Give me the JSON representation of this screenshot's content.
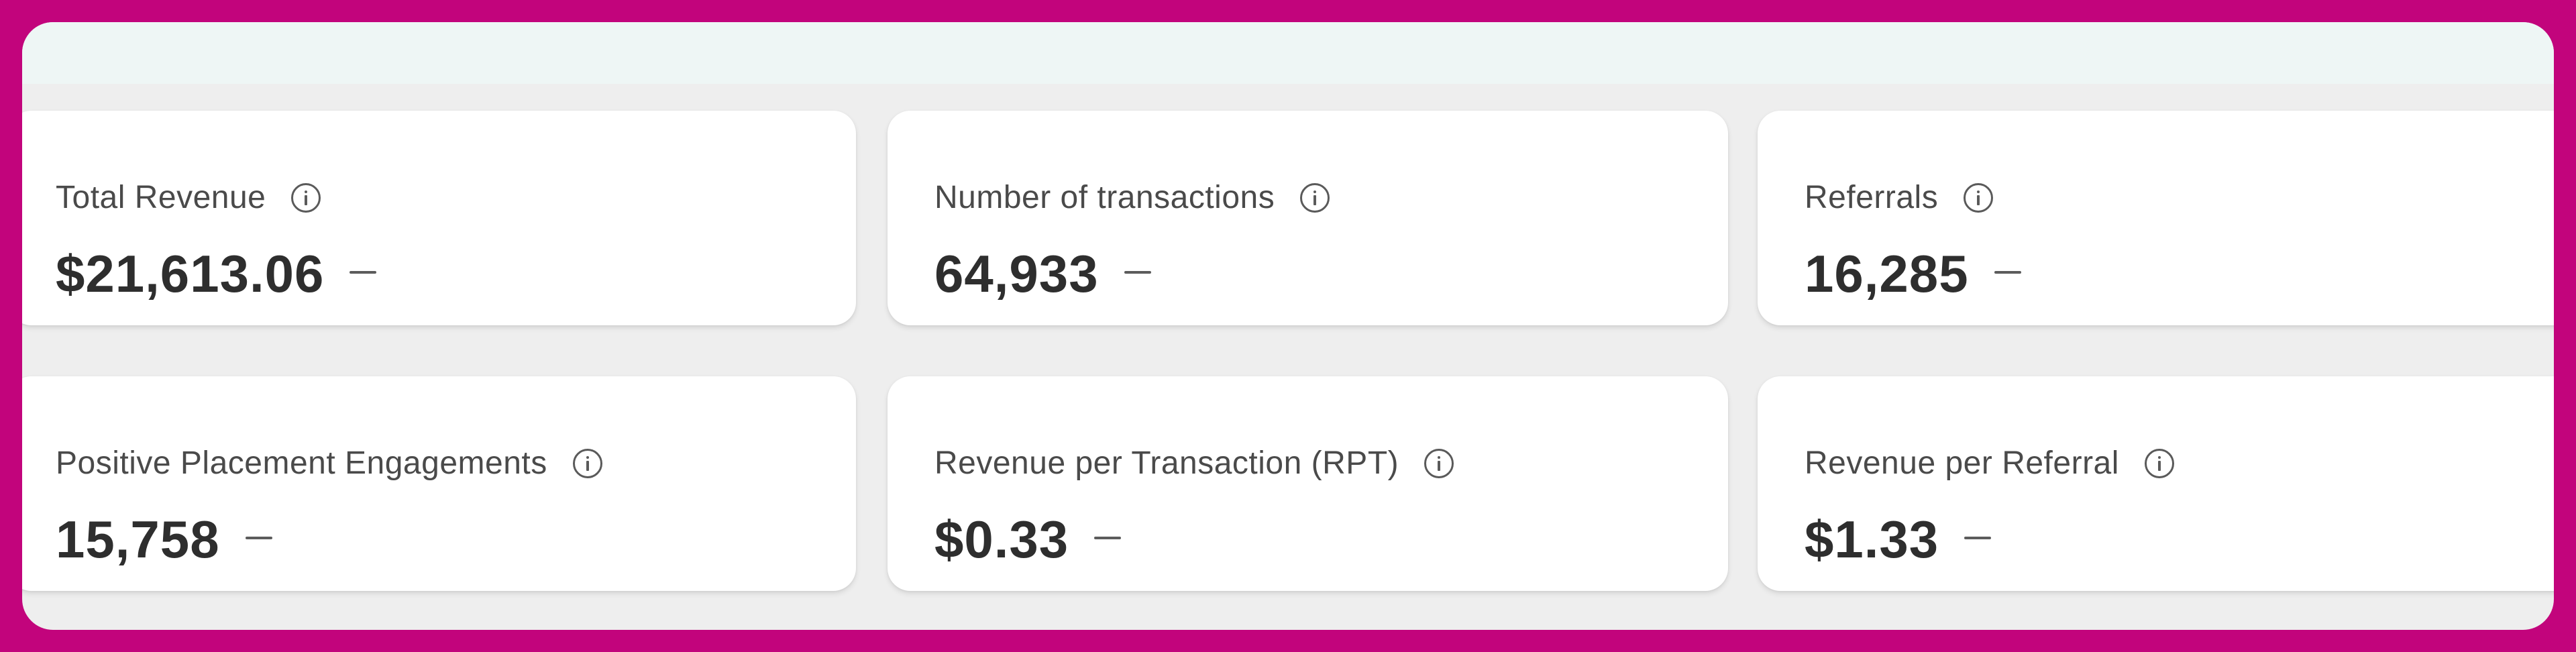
{
  "metrics": [
    {
      "label": "Total Revenue",
      "value": "$21,613.06",
      "trend": "—"
    },
    {
      "label": "Number of transactions",
      "value": "64,933",
      "trend": "—"
    },
    {
      "label": "Referrals",
      "value": "16,285",
      "trend": "—"
    },
    {
      "label": "Positive Placement Engagements",
      "value": "15,758",
      "trend": "—"
    },
    {
      "label": "Revenue per Transaction (RPT)",
      "value": "$0.33",
      "trend": "—"
    },
    {
      "label": "Revenue per Referral",
      "value": "$1.33",
      "trend": "—"
    }
  ],
  "colors": {
    "frame": "#c2047c",
    "panel": "#eeeeee",
    "top_band": "#eef6f5",
    "card": "#ffffff",
    "text": "#2e2e2e"
  },
  "icons": {
    "info": "info-circle-icon",
    "trend": "dash-icon"
  }
}
